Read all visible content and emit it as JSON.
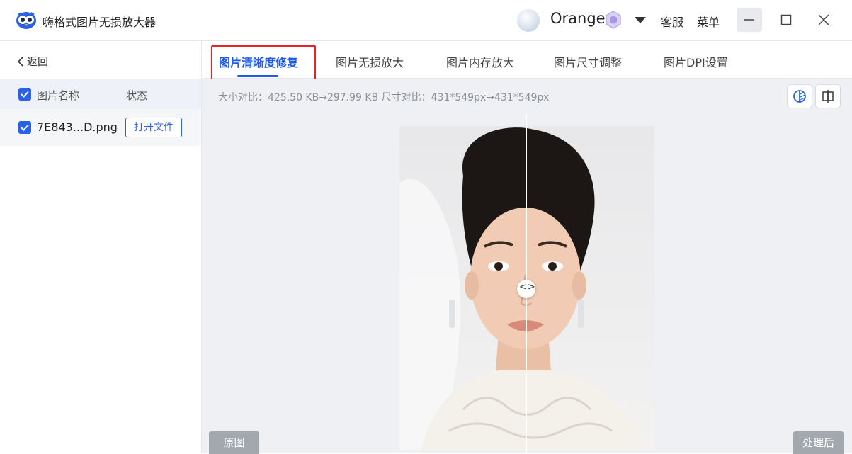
{
  "app": {
    "title": "嗨格式图片无损放大器",
    "username": "Orange",
    "service_label": "客服",
    "menu_label": "菜单"
  },
  "sidebar": {
    "back_label": "返回",
    "column_name": "图片名称",
    "column_status": "状态",
    "files": [
      {
        "name": "7E843...D.png",
        "action": "打开文件",
        "checked": true
      }
    ]
  },
  "tabs": [
    {
      "label": "图片清晰度修复",
      "active": true
    },
    {
      "label": "图片无损放大",
      "active": false
    },
    {
      "label": "图片内存放大",
      "active": false
    },
    {
      "label": "图片尺寸调整",
      "active": false
    },
    {
      "label": "图片DPI设置",
      "active": false
    }
  ],
  "compare": {
    "info": "大小对比：425.50 KB→297.99 KB   尺寸对比：431*549px→431*549px",
    "before_label": "原图",
    "after_label": "处理后",
    "slider_glyph": "<>"
  },
  "colors": {
    "accent": "#2a62e6",
    "active_tab": "#1f5ae8",
    "highlight": "#e52525",
    "tag_bg": "#a3a7ae"
  },
  "icons": [
    "app-logo-icon",
    "vip-badge-icon",
    "chevron-down-icon",
    "minimize-icon",
    "maximize-icon",
    "close-icon",
    "chevron-left-icon",
    "checkbox-checked-icon",
    "compare-split-icon",
    "compare-side-icon"
  ]
}
